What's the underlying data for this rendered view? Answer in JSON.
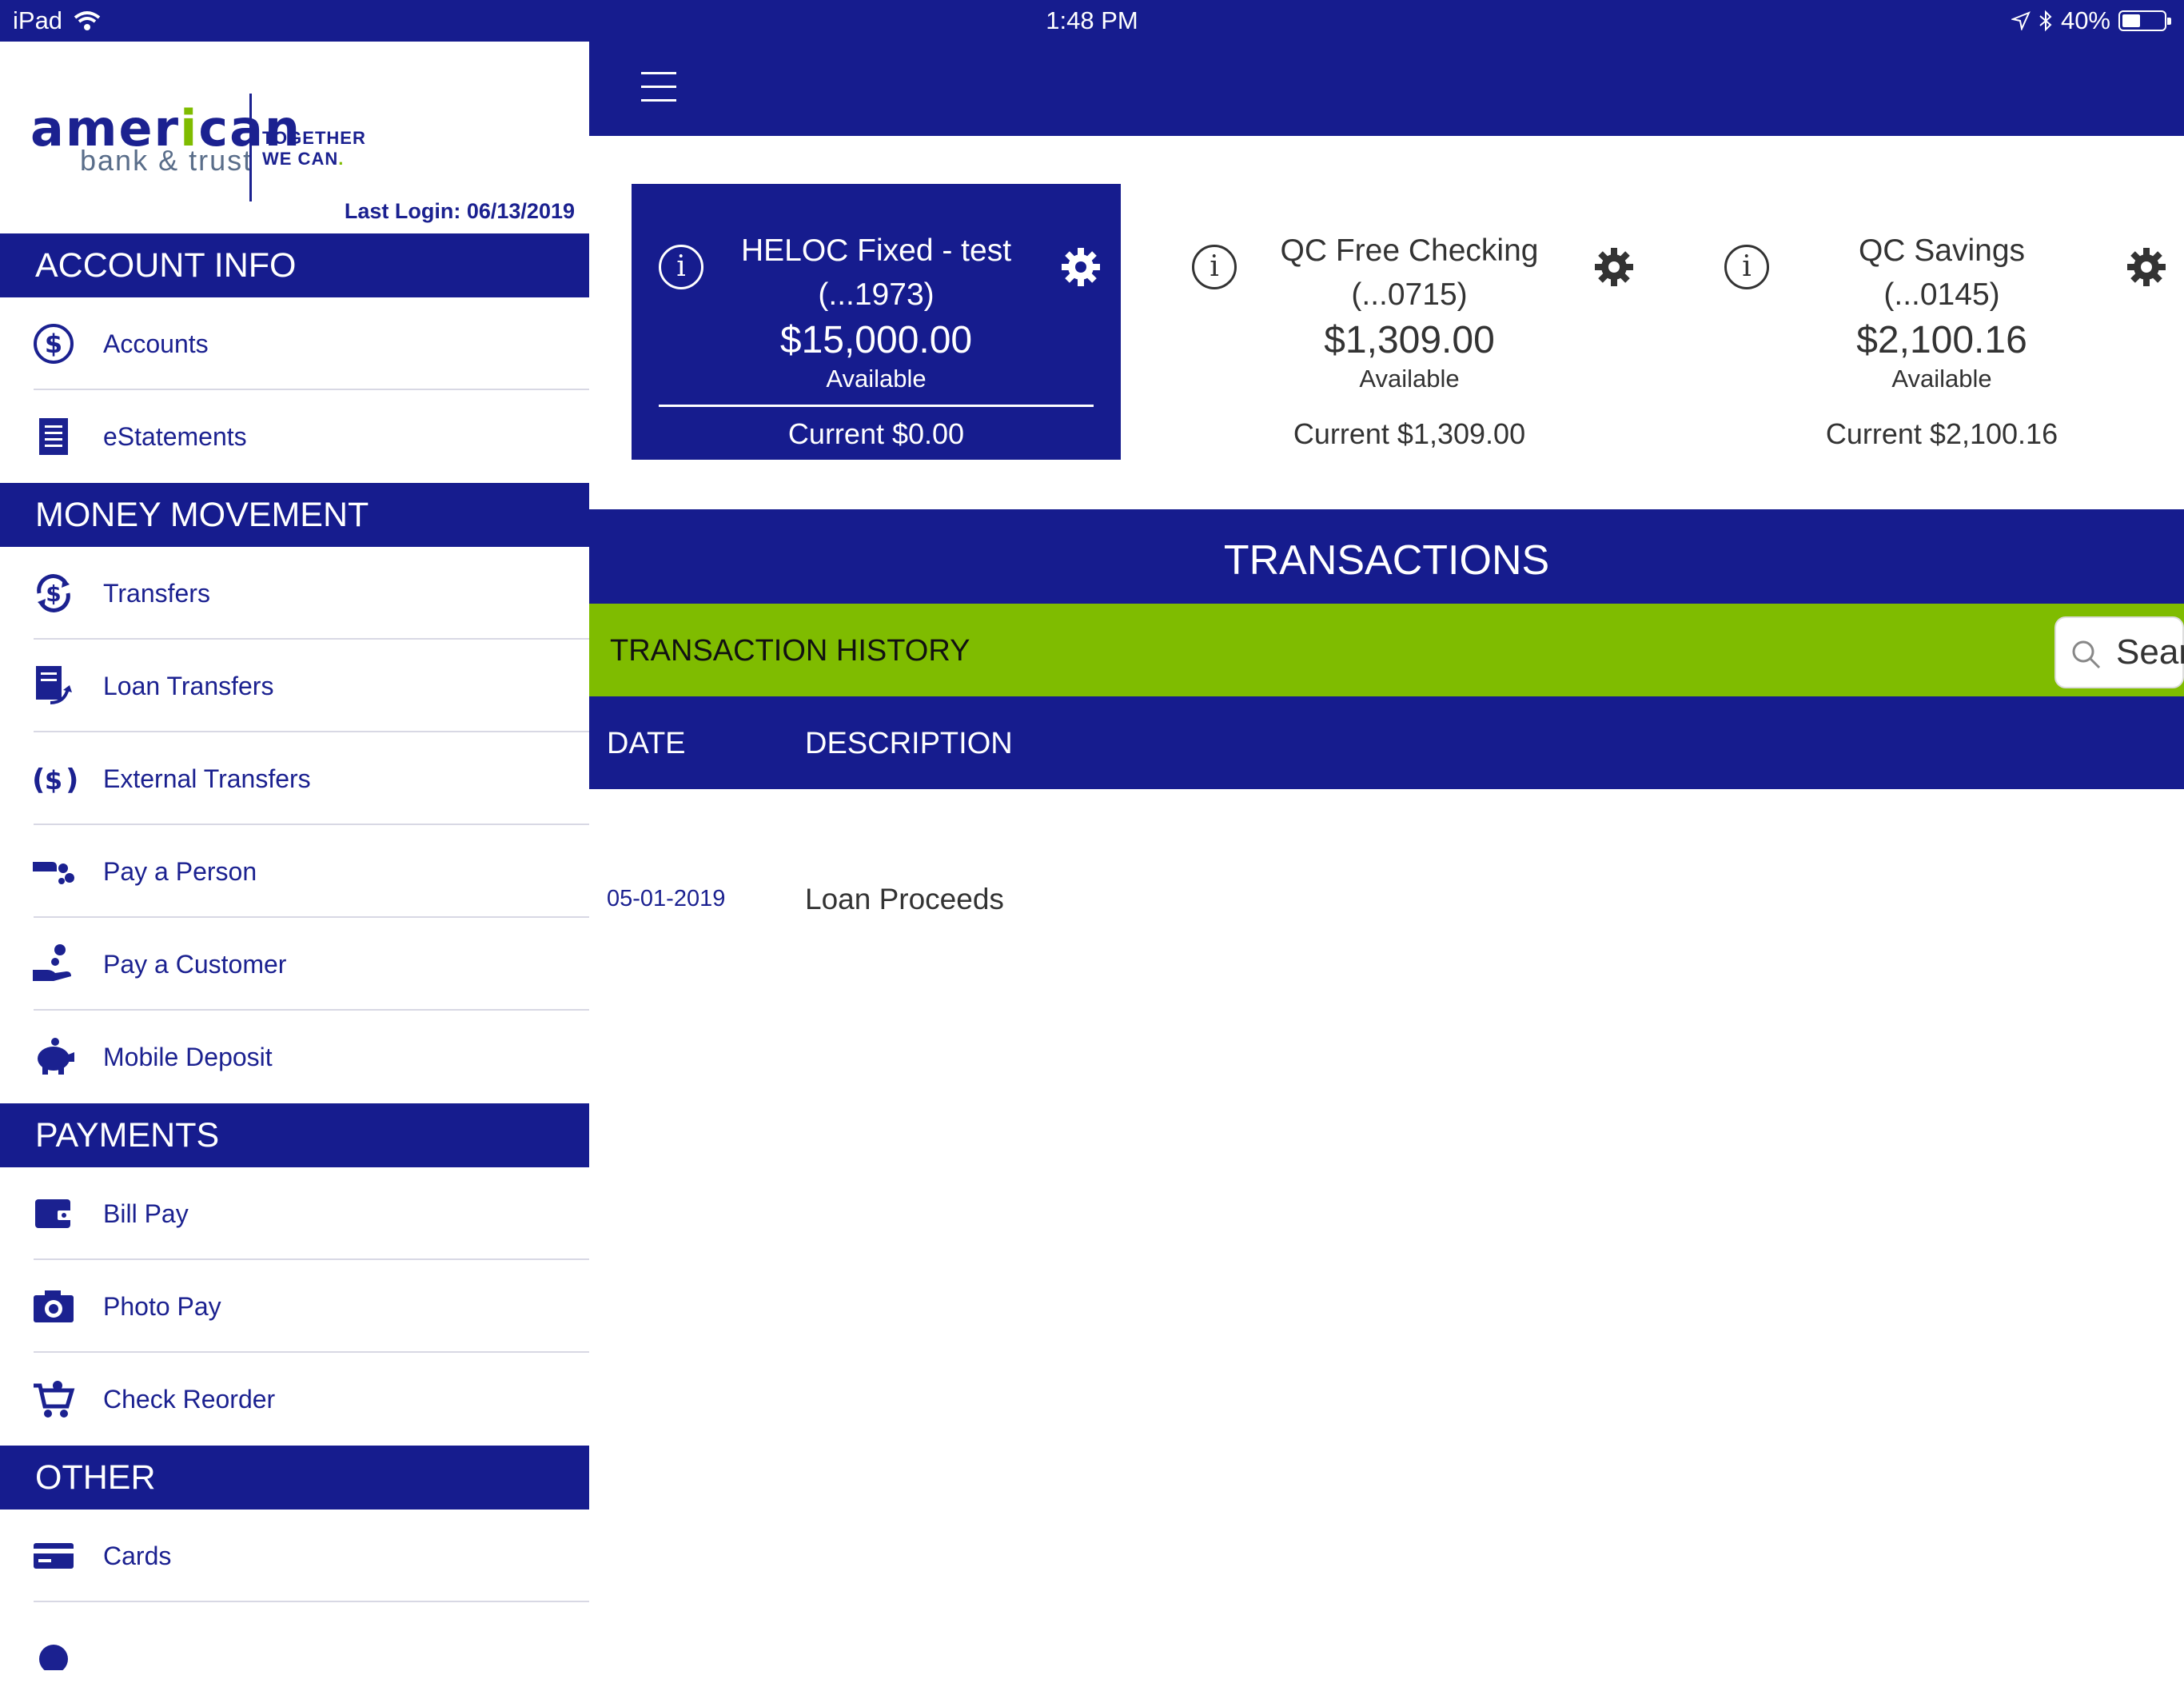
{
  "status_bar": {
    "device": "iPad",
    "time": "1:48 PM",
    "battery": "40%"
  },
  "brand": {
    "name_prefix": "amer",
    "name_i": "i",
    "name_suffix": "can",
    "subtitle": "bank & trust",
    "tagline_1": "TOGETHER",
    "tagline_2": "WE CAN",
    "tagline_dot": "."
  },
  "last_login": "Last Login:  06/13/2019",
  "sidebar": {
    "sections": {
      "account_info": "ACCOUNT INFO",
      "money_movement": "MONEY MOVEMENT",
      "payments": "PAYMENTS",
      "other": "OTHER"
    },
    "items": {
      "accounts": "Accounts",
      "estatements": "eStatements",
      "transfers": "Transfers",
      "loan_transfers": "Loan Transfers",
      "external_transfers": "External Transfers",
      "pay_a_person": "Pay a Person",
      "pay_a_customer": "Pay a Customer",
      "mobile_deposit": "Mobile Deposit",
      "bill_pay": "Bill Pay",
      "photo_pay": "Photo Pay",
      "check_reorder": "Check Reorder",
      "cards": "Cards"
    }
  },
  "accounts": [
    {
      "name_line1": "HELOC Fixed - test",
      "name_line2": "(...1973)",
      "balance": "$15,000.00",
      "balance_label": "Available",
      "current": "Current $0.00"
    },
    {
      "name_line1": "QC Free Checking",
      "name_line2": "(...0715)",
      "balance": "$1,309.00",
      "balance_label": "Available",
      "current": "Current $1,309.00"
    },
    {
      "name_line1": "QC Savings",
      "name_line2": "(...0145)",
      "balance": "$2,100.16",
      "balance_label": "Available",
      "current": "Current $2,100.16"
    }
  ],
  "transactions": {
    "title": "TRANSACTIONS",
    "history_title": "TRANSACTION HISTORY",
    "search_placeholder": "Sear",
    "columns": {
      "date": "DATE",
      "description": "DESCRIPTION"
    },
    "rows": [
      {
        "date": "05-01-2019",
        "description": "Loan Proceeds"
      }
    ]
  },
  "colors": {
    "navy": "#161c8e",
    "green": "#7fbc00",
    "white": "#ffffff"
  }
}
